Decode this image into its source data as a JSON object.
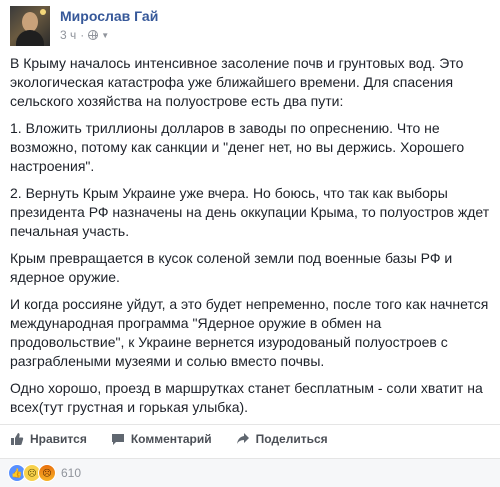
{
  "author": {
    "name": "Мирослав Гай",
    "time": "3 ч",
    "privacy_icon": "globe-icon"
  },
  "post": {
    "paragraphs": [
      "В Крыму началось интенсивное засоление почв и грунтовых вод. Это\nэкологическая катастрофа уже ближайшего времени. Для спасения\nсельского хозяйства на полуострове есть два пути:",
      "1. Вложить триллионы долларов в заводы по опреснению. Что не\nвозможно, потому как санкции и \"денег нет, но вы держись. Хорошего\nнастроения\".",
      "2. Вернуть Крым Украине уже вчера. Но боюсь, что так как выборы\nпрезидента РФ назначены на день оккупации Крыма, то полуостров ждет\nпечальная участь.",
      "Крым превращается в кусок соленой земли под военные базы РФ и\nядерное оружие.",
      "И когда россияне уйдут, а это будет непременно, после того как начнется\nмеждународная программа \"Ядерное оружие в обмен на\nпродовольствие\", к Украине вернется изуродованый полуостроев с\nразграблеными музеями и солью вместо почвы.",
      "Одно хорошо, проезд в маршрутках станет бесплатным - соли хватит на\nвсех(тут грустная и горькая улыбка)."
    ]
  },
  "actions": {
    "like": "Нравится",
    "comment": "Комментарий",
    "share": "Поделиться"
  },
  "reactions": {
    "count": "610",
    "types": [
      "like",
      "sad",
      "angry"
    ]
  },
  "colors": {
    "author_link": "#365899",
    "meta": "#90949c",
    "action_text": "#4b4f56"
  }
}
